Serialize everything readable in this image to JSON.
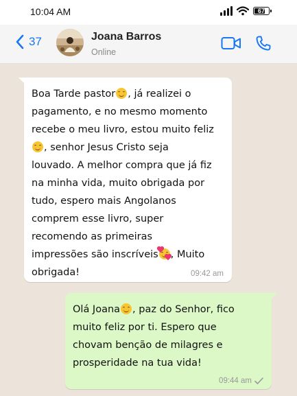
{
  "status_bar": {
    "time": "10:04 AM",
    "battery": "67"
  },
  "header": {
    "back_count": "37",
    "contact_name": "Joana Barros",
    "contact_status": "Online",
    "accent_color": "#1877f2"
  },
  "messages": [
    {
      "direction": "incoming",
      "text_parts": [
        "Boa Tarde pastor",
        ", já realizei o\npagamento, e no mesmo momento\nrecebe o meu livro, estou muito feliz\n",
        ", senhor Jesus Cristo seja\nlouvado. A melhor compra que já fiz\nna minha vida, muito obrigada por\ntudo, espero mais Angolanos\ncomprem esse livro, super\nrecomendo as primeiras\nimpressões são inscríveis",
        ", Muito\nobrigada!"
      ],
      "emojis": [
        "smiling-face",
        "smiling-face",
        "smiling-face-with-hearts"
      ],
      "time": "09:42 am"
    },
    {
      "direction": "outgoing",
      "text_parts": [
        "Olá Joana",
        ", paz do Senhor, fico\nmuito feliz por ti. Espero que\nchovam benção de milagres e\nprosperidade na tua vida!"
      ],
      "emojis": [
        "smiling-face"
      ],
      "time": "09:44 am",
      "status": "sent"
    }
  ],
  "colors": {
    "chat_background": "#ece4da",
    "incoming_bubble": "#ffffff",
    "outgoing_bubble": "#dcf8c6"
  }
}
